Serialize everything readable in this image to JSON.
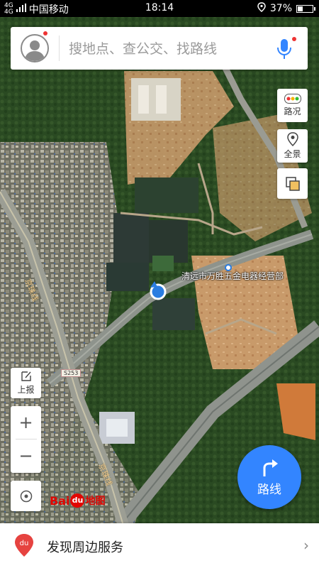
{
  "status_bar": {
    "network_small": "4G",
    "signal_small": "4G",
    "carrier": "中国移动",
    "time": "18:14",
    "battery_percent": "37%",
    "battery_level": 0.37
  },
  "search": {
    "placeholder": "搜地点、查公交、找路线"
  },
  "map_controls": {
    "traffic_label": "路况",
    "panorama_label": "全景",
    "report_label": "上报",
    "zoom_in": "+",
    "zoom_out": "−"
  },
  "map": {
    "poi_label": "清远市万胜五金电器经营部",
    "road_name_1": "京珠线",
    "road_name_2": "京珠线",
    "road_shield": "S253"
  },
  "route_button": {
    "label": "路线"
  },
  "logo": {
    "text_bai": "Bai",
    "text_du": "du",
    "text_ditu": "地图"
  },
  "bottom_bar": {
    "badge": "du",
    "label": "发现周边服务",
    "chevron": "›"
  },
  "colors": {
    "accent": "#3385ff",
    "notification": "#e33333",
    "logo_red": "#e10602",
    "logo_blue": "#2319dc"
  }
}
